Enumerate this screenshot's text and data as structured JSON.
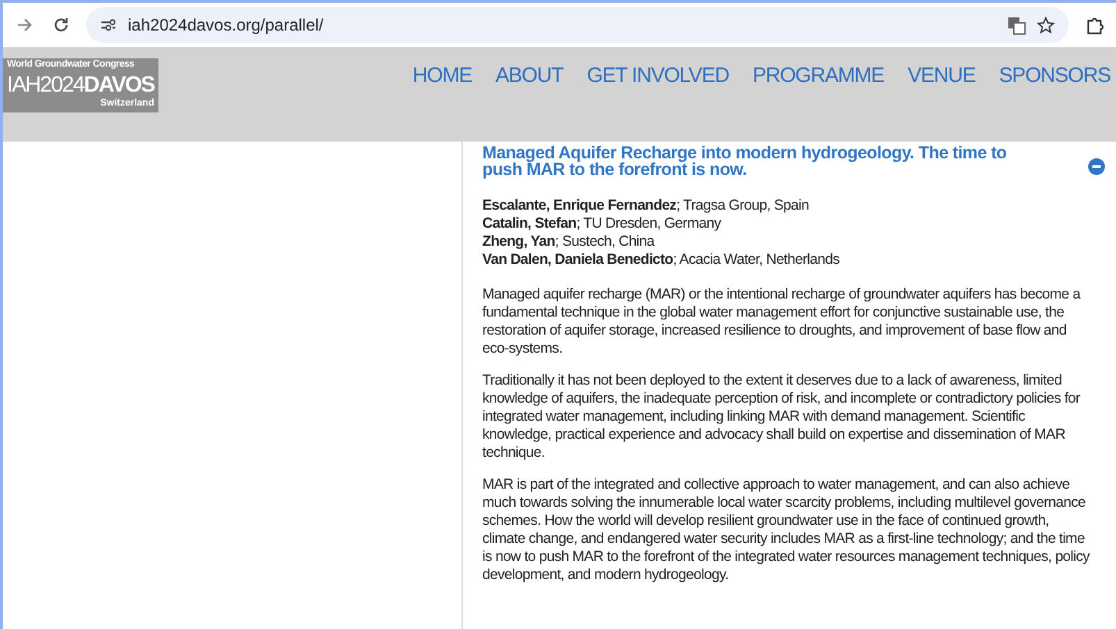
{
  "browser": {
    "url": "iah2024davos.org/parallel/"
  },
  "logo": {
    "tagline": "World Groundwater Congress",
    "wordmark": "IAH2024**DAVOS**",
    "place": "Switzerland"
  },
  "nav": [
    {
      "label": "HOME"
    },
    {
      "label": "ABOUT"
    },
    {
      "label": "GET INVOLVED"
    },
    {
      "label": "PROGRAMME"
    },
    {
      "label": "VENUE"
    },
    {
      "label": "SPONSORS"
    }
  ],
  "article": {
    "title": "Managed Aquifer Recharge into modern hydrogeology. The time to push MAR to the forefront is now.",
    "expanded": true,
    "authors": [
      {
        "name": "Escalante, Enrique Fernandez",
        "affiliation": "; Tragsa Group, Spain"
      },
      {
        "name": "Catalin, Stefan",
        "affiliation": "; TU Dresden, Germany"
      },
      {
        "name": "Zheng, Yan",
        "affiliation": "; Sustech, China"
      },
      {
        "name": "Van Dalen, Daniela Benedicto",
        "affiliation": "; Acacia Water, Netherlands"
      }
    ],
    "paragraphs": [
      "Managed aquifer recharge (MAR) or the intentional recharge of groundwater aquifers has become a fundamental technique in the global water management effort for conjunctive sustainable use, the restoration of aquifer storage, increased resilience to droughts, and improvement of base flow and eco-systems.",
      "Traditionally it has not been deployed to the extent it deserves due to a lack of awareness, limited knowledge of aquifers, the inadequate perception of risk, and incomplete or contradictory policies for integrated water management, including linking MAR with demand management. Scientific knowledge, practical experience and advocacy shall build on expertise and dissemination of MAR technique.",
      "MAR is part of the integrated and collective approach to water management, and can also achieve much towards solving the innumerable local water scarcity problems, including multilevel governance schemes. How the world will develop resilient groundwater use in the face of continued growth, climate change, and endangered water security includes MAR as a first-line technology; and the time is now to push MAR to the forefront of the integrated water resources management techniques, policy development, and modern hydrogeology."
    ]
  }
}
